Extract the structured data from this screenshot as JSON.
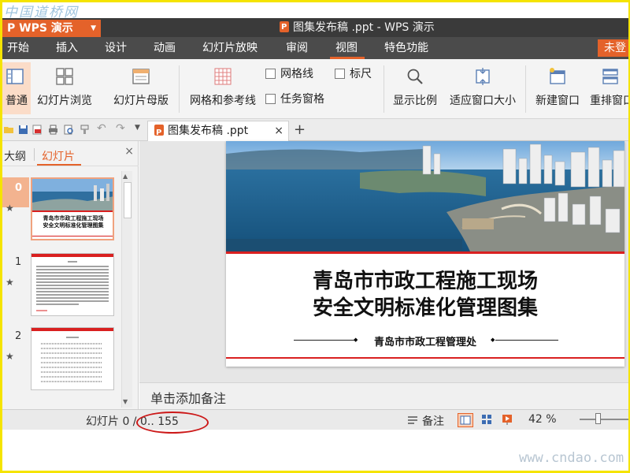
{
  "watermark": {
    "top": "中国道桥网",
    "bottom": "www.cndao.com"
  },
  "app": {
    "menu_button": "P WPS 演示",
    "title": "图集发布稿 .ppt - WPS 演示"
  },
  "menu": {
    "items": [
      "开始",
      "插入",
      "设计",
      "动画",
      "幻灯片放映",
      "审阅",
      "视图",
      "特色功能"
    ],
    "active": "视图",
    "unsaved": "未登"
  },
  "ribbon": {
    "normal": "普通",
    "slide_sorter": "幻灯片浏览",
    "slide_master": "幻灯片母版",
    "grid_guides": "网格和参考线",
    "gridlines": "网格线",
    "ruler": "标尺",
    "task_pane": "任务窗格",
    "zoom": "显示比例",
    "fit_window": "适应窗口大小",
    "new_window": "新建窗口",
    "arrange": "重排窗口"
  },
  "doc_tab": {
    "label": "图集发布稿 .ppt",
    "close": "×",
    "add": "+"
  },
  "left_panel": {
    "tabs": [
      "大纲",
      "幻灯片"
    ],
    "active_tab": "幻灯片",
    "close": "×",
    "thumbnails": [
      {
        "num": "0",
        "title_line1": "青岛市市政工程施工现场",
        "title_line2": "安全文明标准化管理图集"
      },
      {
        "num": "1"
      },
      {
        "num": "2"
      }
    ]
  },
  "slide": {
    "title_line1": "青岛市市政工程施工现场",
    "title_line2": "安全文明标准化管理图集",
    "subtitle": "青岛市市政工程管理处"
  },
  "notes_placeholder": "单击添加备注",
  "status": {
    "slide_info": "幻灯片 0 / 0.. 155",
    "notes": "备注",
    "zoom": "42 %",
    "zoom_level_percent": 42
  },
  "colors": {
    "accent": "#e4622a",
    "title_bar": "#3a3a3a",
    "menu_bar": "#4b4b4b",
    "slide_red": "#d92020",
    "highlight_ellipse": "#cc1818"
  }
}
